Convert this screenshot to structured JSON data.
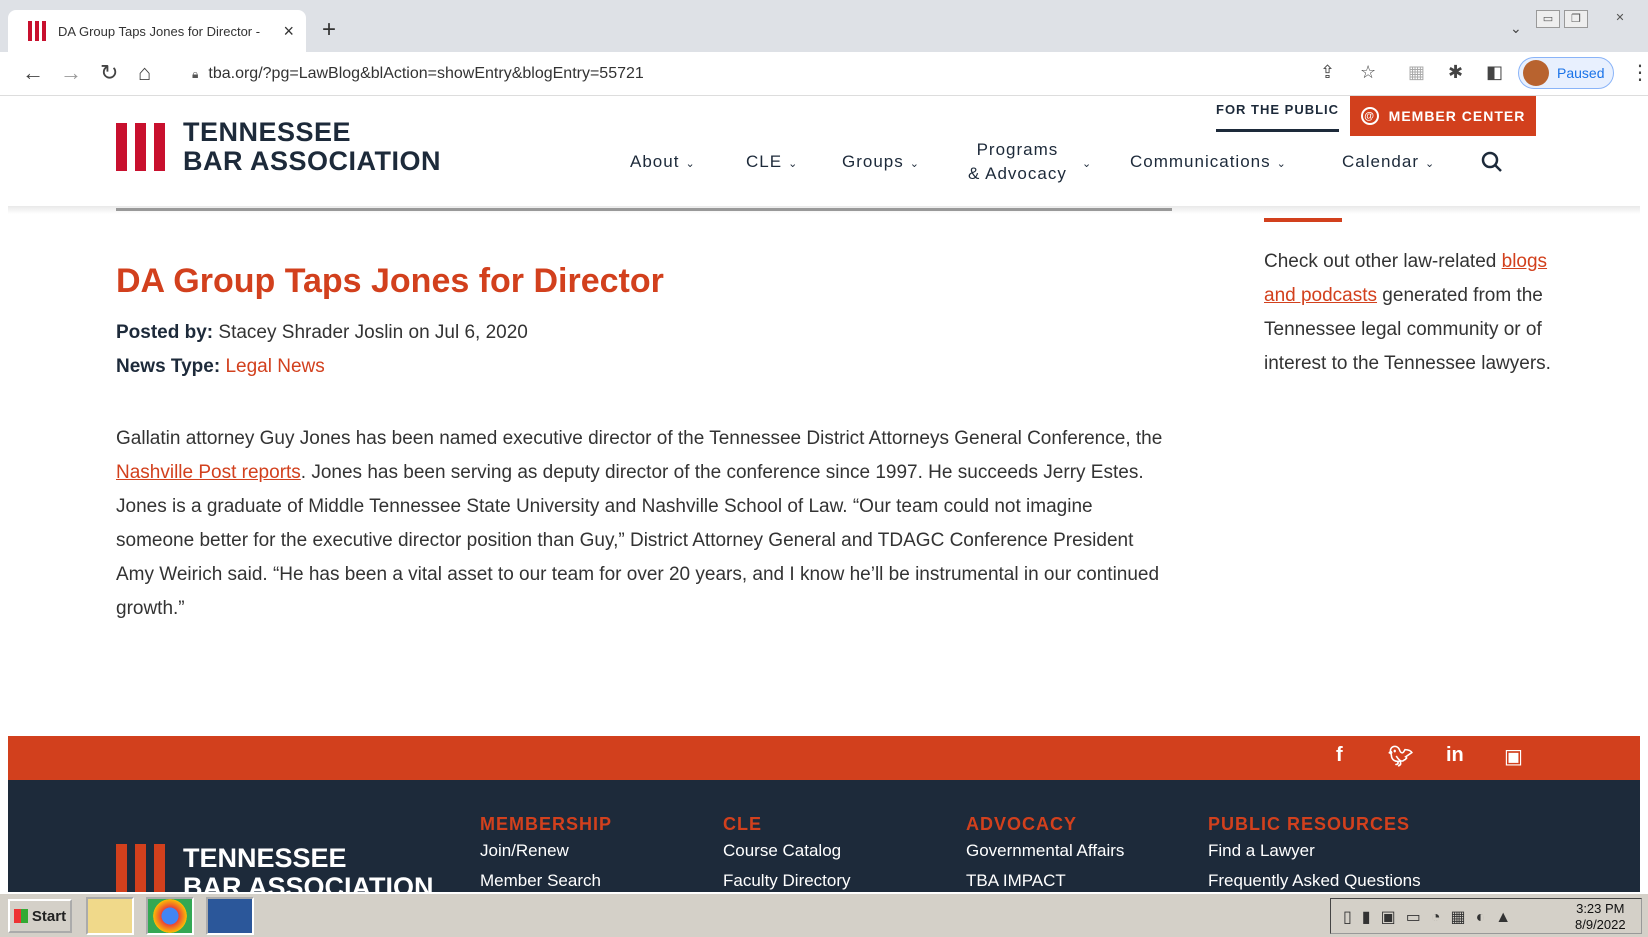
{
  "browser": {
    "tab_title": "DA Group Taps Jones for Director -",
    "tab_close": "×",
    "new_tab": "+",
    "url": "tba.org/?pg=LawBlog&blAction=showEntry&blogEntry=55721",
    "profile_label": "Paused",
    "icons": [
      "back-icon",
      "forward-icon",
      "reload-icon",
      "home-icon",
      "lock-icon",
      "share-icon",
      "star-icon",
      "extension-icon",
      "puzzle-icon",
      "sidepanel-icon",
      "menu-icon"
    ]
  },
  "site": {
    "logo_line1": "TENNESSEE",
    "logo_line2": "BAR ASSOCIATION",
    "for_public": "FOR THE PUBLIC",
    "member_center": "MEMBER CENTER",
    "nav": [
      {
        "label": "About"
      },
      {
        "label": "CLE"
      },
      {
        "label": "Groups"
      },
      {
        "label": "Programs"
      },
      {
        "label": "& Advocacy"
      },
      {
        "label": "Communications"
      },
      {
        "label": "Calendar"
      }
    ],
    "accent_color": "#d2401d",
    "navy_color": "#1d2a3a"
  },
  "article": {
    "title": "DA Group Taps Jones for Director",
    "posted_by_label": "Posted by:",
    "posted_by_value": "Stacey Shrader Joslin on Jul 6, 2020",
    "news_type_label": "News Type:",
    "news_type_value": "Legal News",
    "body_part1": "Gallatin attorney Guy Jones has been named executive director of the Tennessee District Attorneys General Conference, the ",
    "body_link": "Nashville Post reports",
    "body_part2": ". Jones has been serving as deputy director of the conference since 1997. He succeeds Jerry Estes. Jones is a graduate of Middle Tennessee State University and Nashville School of Law. “Our team could not imagine someone better for the executive director position than Guy,” District Attorney General and TDAGC Conference President Amy Weirich said. “He has been a vital asset to our team for over 20 years, and I know he’ll be instrumental in our continued growth.”"
  },
  "sidebar": {
    "part1": "Check out other law-related ",
    "link": "blogs and podcasts",
    "part2": " generated from the Tennessee legal community or of interest to the Tennessee lawyers."
  },
  "footer": {
    "social": [
      "f",
      "t",
      "in",
      "yt"
    ],
    "logo_line1": "TENNESSEE",
    "logo_line2": "BAR ASSOCIATION",
    "columns": [
      {
        "heading": "MEMBERSHIP",
        "links": [
          "Join/Renew",
          "Member Search"
        ]
      },
      {
        "heading": "CLE",
        "links": [
          "Course Catalog",
          "Faculty Directory"
        ]
      },
      {
        "heading": "ADVOCACY",
        "links": [
          "Governmental Affairs",
          "TBA IMPACT"
        ]
      },
      {
        "heading": "PUBLIC RESOURCES",
        "links": [
          "Find a Lawyer",
          "Frequently Asked Questions"
        ]
      }
    ]
  },
  "taskbar": {
    "start": "Start",
    "time": "3:23 PM",
    "date": "8/9/2022"
  }
}
